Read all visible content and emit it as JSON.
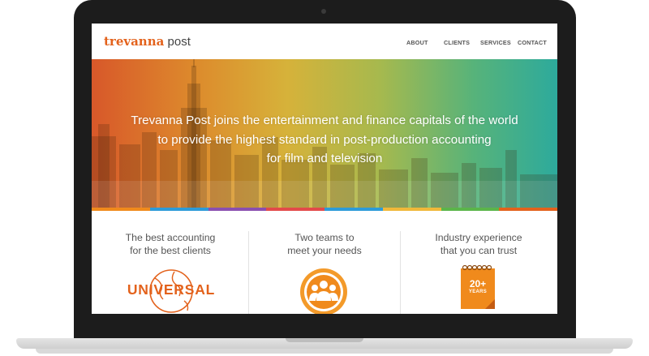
{
  "site": {
    "logo_part1": "trevanna",
    "logo_part2": "post"
  },
  "nav": {
    "items": [
      "ABOUT",
      "CLIENTS",
      "SERVICES",
      "CONTACT"
    ]
  },
  "hero": {
    "lines": [
      "Trevanna Post joins the entertainment and finance capitals of the world",
      "to provide the highest standard in post-production accounting",
      "for film and television"
    ]
  },
  "features": [
    {
      "line1": "The best accounting",
      "line2": "for the best clients",
      "icon": "universal-logo"
    },
    {
      "line1": "Two teams to",
      "line2": "meet your needs",
      "icon": "people-icon"
    },
    {
      "line1": "Industry experience",
      "line2": "that you can trust",
      "icon": "calendar-icon"
    }
  ],
  "universal_logo_text": "UNIVERSAL",
  "calendar": {
    "number": "20+",
    "label": "YEARS"
  },
  "colors": {
    "brand_orange": "#e3621c",
    "stripe": [
      "#f08a1c",
      "#2d9bd8",
      "#8a4fb0",
      "#e34a4a",
      "#2d9bd8",
      "#f0b83a",
      "#5bb54a",
      "#e3621c"
    ]
  }
}
